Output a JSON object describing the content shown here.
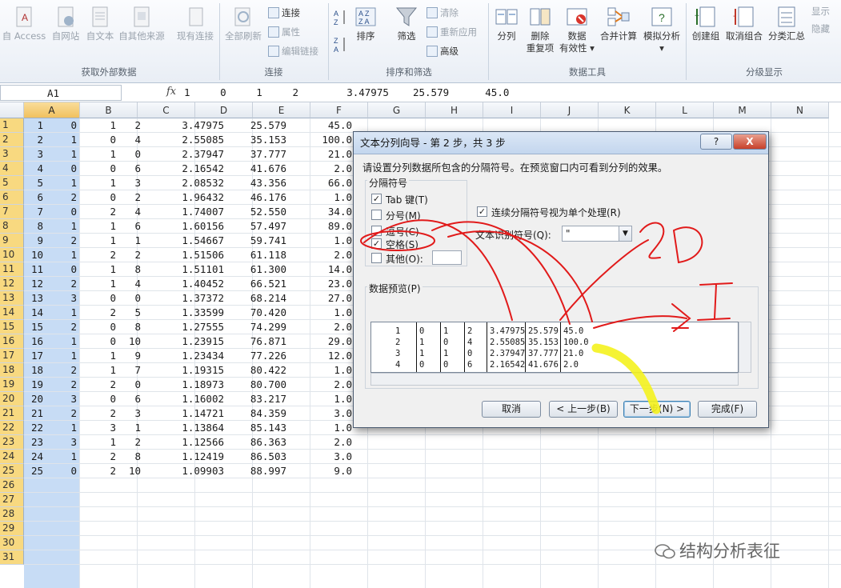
{
  "ribbon": {
    "get_external": {
      "buttons": [
        {
          "label": "自 Access"
        },
        {
          "label": "自网站"
        },
        {
          "label": "自文本"
        },
        {
          "label": "自其他来源"
        },
        {
          "label": "现有连接"
        }
      ],
      "group_label": "获取外部数据"
    },
    "connections": {
      "refresh_label": "全部刷新",
      "items": [
        {
          "label": "连接"
        },
        {
          "label": "属性"
        },
        {
          "label": "编辑链接"
        }
      ],
      "group_label": "连接"
    },
    "sort_filter": {
      "sort_label": "排序",
      "filter_label": "筛选",
      "items": [
        {
          "label": "清除"
        },
        {
          "label": "重新应用"
        },
        {
          "label": "高级"
        }
      ],
      "group_label": "排序和筛选"
    },
    "data_tools": {
      "buttons": [
        {
          "label": "分列"
        },
        {
          "label": "删除",
          "label2": "重复项"
        },
        {
          "label": "数据",
          "label2": "有效性 ▾"
        },
        {
          "label": "合并计算"
        },
        {
          "label": "模拟分析 ▾"
        }
      ],
      "group_label": "数据工具"
    },
    "outline": {
      "buttons": [
        {
          "label": "创建组"
        },
        {
          "label": "取消组合"
        },
        {
          "label": "分类汇总"
        }
      ],
      "extra": [
        {
          "label": "显示"
        },
        {
          "label": "隐藏"
        }
      ],
      "group_label": "分级显示"
    }
  },
  "formula_bar": {
    "name_box": "A1",
    "fx": "fx",
    "content": "1     0     1     2        3.47975    25.579      45.0"
  },
  "sheet": {
    "columns": [
      "A",
      "B",
      "C",
      "D",
      "E",
      "F",
      "G",
      "H",
      "I",
      "J",
      "K",
      "L",
      "M",
      "N"
    ],
    "row_numbers": [
      "1",
      "2",
      "3",
      "4",
      "5",
      "6",
      "7",
      "8",
      "9",
      "10",
      "11",
      "12",
      "13",
      "14",
      "15",
      "16",
      "17",
      "18",
      "19",
      "20",
      "21",
      "22",
      "23",
      "24",
      "25",
      "26",
      "27",
      "28",
      "29",
      "30",
      "31"
    ],
    "rows": [
      [
        "1",
        "0",
        "1",
        "2",
        "3.47975",
        "25.579",
        "45.0"
      ],
      [
        "2",
        "1",
        "0",
        "4",
        "2.55085",
        "35.153",
        "100.0"
      ],
      [
        "3",
        "1",
        "1",
        "0",
        "2.37947",
        "37.777",
        "21.0"
      ],
      [
        "4",
        "0",
        "0",
        "6",
        "2.16542",
        "41.676",
        "2.0"
      ],
      [
        "5",
        "1",
        "1",
        "3",
        "2.08532",
        "43.356",
        "66.0"
      ],
      [
        "6",
        "2",
        "0",
        "2",
        "1.96432",
        "46.176",
        "1.0"
      ],
      [
        "7",
        "0",
        "2",
        "4",
        "1.74007",
        "52.550",
        "34.0"
      ],
      [
        "8",
        "1",
        "1",
        "6",
        "1.60156",
        "57.497",
        "89.0"
      ],
      [
        "9",
        "2",
        "1",
        "1",
        "1.54667",
        "59.741",
        "1.0"
      ],
      [
        "10",
        "1",
        "2",
        "2",
        "1.51506",
        "61.118",
        "2.0"
      ],
      [
        "11",
        "0",
        "1",
        "8",
        "1.51101",
        "61.300",
        "14.0"
      ],
      [
        "12",
        "2",
        "1",
        "4",
        "1.40452",
        "66.521",
        "23.0"
      ],
      [
        "13",
        "3",
        "0",
        "0",
        "1.37372",
        "68.214",
        "27.0"
      ],
      [
        "14",
        "1",
        "2",
        "5",
        "1.33599",
        "70.420",
        "1.0"
      ],
      [
        "15",
        "2",
        "0",
        "8",
        "1.27555",
        "74.299",
        "2.0"
      ],
      [
        "16",
        "1",
        "0",
        "10",
        "1.23915",
        "76.871",
        "29.0"
      ],
      [
        "17",
        "1",
        "1",
        "9",
        "1.23434",
        "77.226",
        "12.0"
      ],
      [
        "18",
        "2",
        "1",
        "7",
        "1.19315",
        "80.422",
        "1.0"
      ],
      [
        "19",
        "2",
        "2",
        "0",
        "1.18973",
        "80.700",
        "2.0"
      ],
      [
        "20",
        "3",
        "0",
        "6",
        "1.16002",
        "83.217",
        "1.0"
      ],
      [
        "21",
        "2",
        "2",
        "3",
        "1.14721",
        "84.359",
        "3.0"
      ],
      [
        "22",
        "1",
        "3",
        "1",
        "1.13864",
        "85.143",
        "1.0"
      ],
      [
        "23",
        "3",
        "1",
        "2",
        "1.12566",
        "86.363",
        "2.0"
      ],
      [
        "24",
        "1",
        "2",
        "8",
        "1.12419",
        "86.503",
        "3.0"
      ],
      [
        "25",
        "0",
        "2",
        "10",
        "1.09903",
        "88.997",
        "9.0"
      ]
    ]
  },
  "dialog": {
    "title": "文本分列向导 - 第 2 步，共 3 步",
    "help": "?",
    "close": "X",
    "instruction": "请设置分列数据所包含的分隔符号。在预览窗口内可看到分列的效果。",
    "separators_label": "分隔符号",
    "separators": [
      {
        "label": "Tab 键(T)",
        "checked": true
      },
      {
        "label": "分号(M)",
        "checked": false
      },
      {
        "label": "逗号(C)",
        "checked": false
      },
      {
        "label": "空格(S)",
        "checked": true
      },
      {
        "label": "其他(O):",
        "checked": false
      }
    ],
    "consecutive": {
      "label": "连续分隔符号视为单个处理(R)",
      "checked": true
    },
    "qualifier_label": "文本识别符号(Q):",
    "qualifier_value": "\"",
    "preview_label": "数据预览(P)",
    "preview_rows": [
      [
        "1",
        "0",
        "1",
        "2",
        "3.47975",
        "25.579",
        "45.0"
      ],
      [
        "2",
        "1",
        "0",
        "4",
        "2.55085",
        "35.153",
        "100.0"
      ],
      [
        "3",
        "1",
        "1",
        "0",
        "2.37947",
        "37.777",
        "21.0"
      ],
      [
        "4",
        "0",
        "0",
        "6",
        "2.16542",
        "41.676",
        "2.0"
      ]
    ],
    "buttons": {
      "cancel": "取消",
      "back": "< 上一步(B)",
      "next": "下一步(N) >",
      "finish": "完成(F)"
    }
  },
  "annotations": {
    "text_2d": "2D",
    "text_i": "I",
    "red": "#e11a1a",
    "yellow": "#f4f21e"
  },
  "watermark": "结构分析表征",
  "colors": {
    "selected_header": "#f1c15f",
    "selected_column": "#c7dcf5",
    "dialog_bg": "#f0f0f0"
  }
}
